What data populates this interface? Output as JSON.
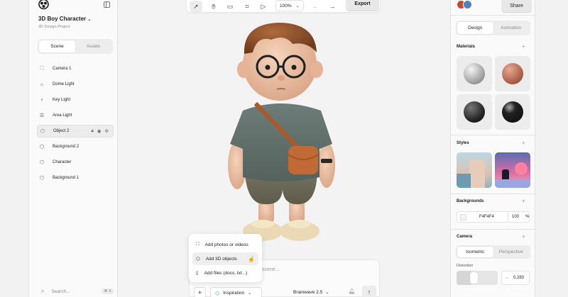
{
  "project": {
    "title": "3D Boy Character",
    "subtitle": "3D Design Project"
  },
  "left_tabs": [
    "Scene",
    "Assets"
  ],
  "layers": [
    {
      "label": "Camera 1",
      "icon": "camera-icon"
    },
    {
      "label": "Dome Light",
      "icon": "sun-icon"
    },
    {
      "label": "Key Light",
      "icon": "bulb-icon"
    },
    {
      "label": "Area Light",
      "icon": "area-light-icon"
    },
    {
      "label": "Object 2",
      "icon": "cube-icon",
      "selected": true
    },
    {
      "label": "Background 2",
      "icon": "cube-icon"
    },
    {
      "label": "Character",
      "icon": "cube-icon"
    },
    {
      "label": "Background 1",
      "icon": "cube-icon"
    }
  ],
  "search": {
    "placeholder": "Search...",
    "shortcut": "⌘ K"
  },
  "toolbar": {
    "zoom": "100%",
    "export_label": "Export"
  },
  "right": {
    "share_label": "Share",
    "tabs": [
      "Design",
      "Animation"
    ],
    "materials_label": "Materials",
    "styles_label": "Styles",
    "backgrounds_label": "Backgrounds",
    "background_hex": "F4F4F4",
    "background_opacity": "100",
    "background_unit": "%",
    "camera_label": "Camera",
    "camera_tabs": [
      "Isometric",
      "Perspective"
    ],
    "distortion_label": "Distortion",
    "distortion_value": "0.283",
    "distortion_fraction": 0.283
  },
  "add_menu": [
    "Add photos or videos",
    "Add 3D objects",
    "Add files (docs, txt...)"
  ],
  "chat": {
    "placeholder": "scene...",
    "inspiration_label": "Inspiration",
    "model_label": "Brainwave 2.5"
  },
  "colors": {
    "accent": "#1d1d1f",
    "panel": "#fafafa",
    "canvas": "#f3f3f3",
    "inspiration_green": "#2fb36a"
  }
}
